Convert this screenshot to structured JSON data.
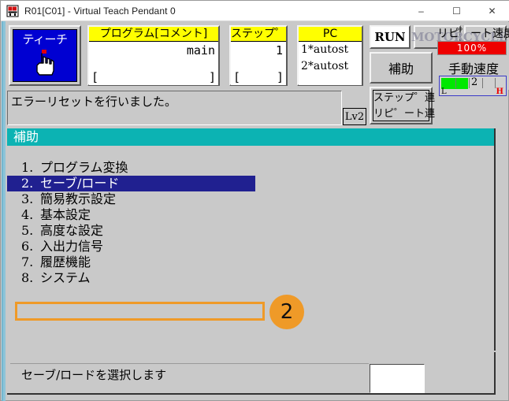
{
  "window": {
    "title": "R01[C01] - Virtual Teach Pendant 0",
    "icon": "app-icon",
    "minimize": "–",
    "maximize": "☐",
    "close": "✕"
  },
  "toolbar": {
    "teach": {
      "label": "ティーチ",
      "icon": "hand-pointer-icon"
    },
    "program": {
      "header": "プログラム[コメント]",
      "value": "main",
      "bracket_left": "[",
      "bracket_right": "]"
    },
    "step": {
      "header": "ステップ゜",
      "value": "1",
      "bracket_left": "[",
      "bracket_right": "]"
    },
    "pc": {
      "header": "PC",
      "line1": "1*autost",
      "line2": "2*autost"
    },
    "run": "RUN",
    "motor": "MOTOR",
    "cycle": "CYCLE",
    "aux": "補助",
    "step_ren": "ステップ゜連",
    "repeat_ren": "リピ゜ート連"
  },
  "speed": {
    "repeat_label": "リピ゜ート速度",
    "repeat_value": "100%",
    "manual_label": "手動速度",
    "manual_value": "2",
    "scale_low": "L",
    "scale_high": "H"
  },
  "message": {
    "text": "エラーリセットを行いました。",
    "level": "Lv2"
  },
  "main": {
    "header": "補助",
    "selected_index": 1,
    "items": [
      {
        "num": "1.",
        "label": "プログラム変換"
      },
      {
        "num": "2.",
        "label": "セーブ/ロード"
      },
      {
        "num": "3.",
        "label": "簡易教示設定"
      },
      {
        "num": "4.",
        "label": "基本設定"
      },
      {
        "num": "5.",
        "label": "高度な設定"
      },
      {
        "num": "6.",
        "label": "入出力信号"
      },
      {
        "num": "7.",
        "label": "履歴機能"
      },
      {
        "num": "8.",
        "label": "システム"
      }
    ]
  },
  "annotation": {
    "step_number": "2"
  },
  "status": {
    "text": "セーブ/ロードを選択します",
    "input_value": ""
  },
  "colors": {
    "teach_bg": "#0000d2",
    "header_yellow": "#ffff00",
    "teal": "#0cb3b3",
    "selected_navy": "#202090",
    "annotation_orange": "#ef9a28",
    "speed_red": "#ee0000",
    "gauge_green": "#00e800",
    "rail_blue": "#8dc4d8"
  }
}
